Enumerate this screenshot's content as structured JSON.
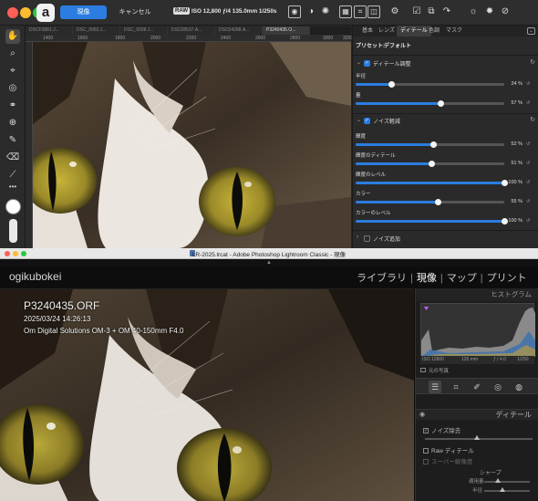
{
  "top_window": {
    "app_logo": "a",
    "buttons": {
      "develop": "現像",
      "cancel": "キャンセル"
    },
    "exif": {
      "badge": "RAW",
      "text": "ISO 12,800 ƒ/4 135.0mm 1/250s"
    },
    "toolbar_icons": [
      "eye-icon",
      "compare-icon",
      "sun-icon",
      "grid-icon",
      "crop-icon",
      "settings-icon",
      "checkbox-icon",
      "transform-icon",
      "redo-icon",
      "sun-plus-icon",
      "sun-minus-icon",
      "eye-slash-icon"
    ],
    "file_tabs": [
      "DSCF0881.J...",
      "DSC_0062.J...",
      "DSC_0028.J...",
      "DSC08537.A...",
      "DSC04288.A...",
      "P3240435.O..."
    ],
    "ruler_ticks": [
      "1400",
      "1600",
      "1800",
      "2000",
      "2200",
      "2400",
      "2600",
      "2800",
      "3000",
      "3200"
    ],
    "panel": {
      "tabs": [
        "基本",
        "レンズ",
        "ディテール",
        "色調",
        "マスク"
      ],
      "active_tab": "ディテール",
      "preset_label": "プリセット:",
      "preset_value": "デフォルト",
      "sections": [
        {
          "title": "ディテール調整",
          "enabled": true,
          "sliders": [
            {
              "label": "半径",
              "value": "24 %",
              "fraction": 0.24
            },
            {
              "label": "量",
              "value": "57 %",
              "fraction": 0.57
            }
          ]
        },
        {
          "title": "ノイズ軽減",
          "enabled": true,
          "sliders": [
            {
              "label": "輝度",
              "value": "52 %",
              "fraction": 0.52
            },
            {
              "label": "輝度のディテール",
              "value": "51 %",
              "fraction": 0.51
            },
            {
              "label": "輝度のレベル",
              "value": "100 %",
              "fraction": 1.0
            },
            {
              "label": "カラー",
              "value": "55 %",
              "fraction": 0.55
            },
            {
              "label": "カラーのレベル",
              "value": "100 %",
              "fraction": 1.0
            }
          ]
        },
        {
          "title": "ノイズ追加",
          "enabled": false,
          "sliders": []
        }
      ]
    }
  },
  "lightroom": {
    "window_title": "LR-2025.lrcat - Adobe Photoshop Lightroom Classic - 現像",
    "identity_plate": "ogikubokei",
    "modules": [
      "ライブラリ",
      "現像",
      "マップ",
      "プリント"
    ],
    "active_module": "現像",
    "photo_info": {
      "filename": "P3240435.ORF",
      "datetime": "2025/03/24 14:26:13",
      "camera": "Om Digital Solutions OM-3 + OM 40-150mm F4.0"
    },
    "histogram": {
      "title": "ヒストグラム",
      "iso": "ISO 12800",
      "focal": "135 mm",
      "aperture": "ƒ / 4.0",
      "shutter": "1/250",
      "original_photo": "元の写真"
    },
    "detail": {
      "title": "ディテール",
      "noise_reduction": "ノイズ除去",
      "raw_detail": "Raw ディテール",
      "super_resolution": "スーパー解像度",
      "sharpen": "シャープ",
      "amount": "適用量",
      "radius": "半径"
    }
  }
}
